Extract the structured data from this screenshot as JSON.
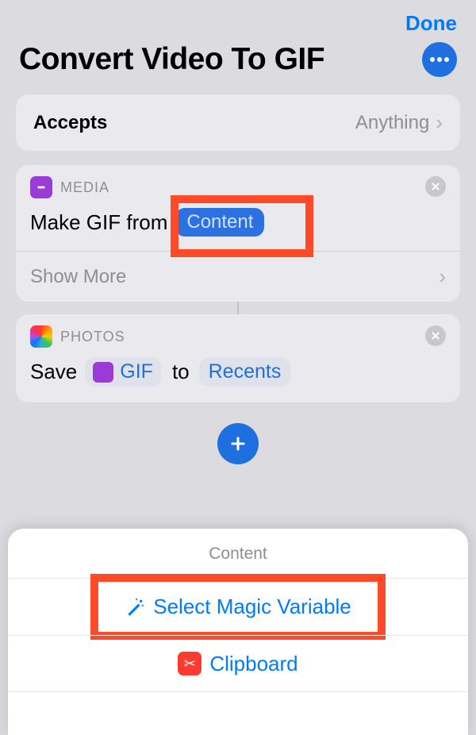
{
  "topbar": {
    "done": "Done"
  },
  "title": "Convert Video To GIF",
  "accepts": {
    "label": "Accepts",
    "value": "Anything"
  },
  "actions": {
    "media": {
      "category": "MEDIA",
      "prefix": "Make GIF from",
      "param_pill": "Content",
      "show_more": "Show More"
    },
    "photos": {
      "category": "PHOTOS",
      "prefix": "Save",
      "gif_token": "GIF",
      "mid": "to",
      "recents_token": "Recents"
    }
  },
  "sheet": {
    "title": "Content",
    "magic": "Select Magic Variable",
    "clipboard": "Clipboard"
  }
}
